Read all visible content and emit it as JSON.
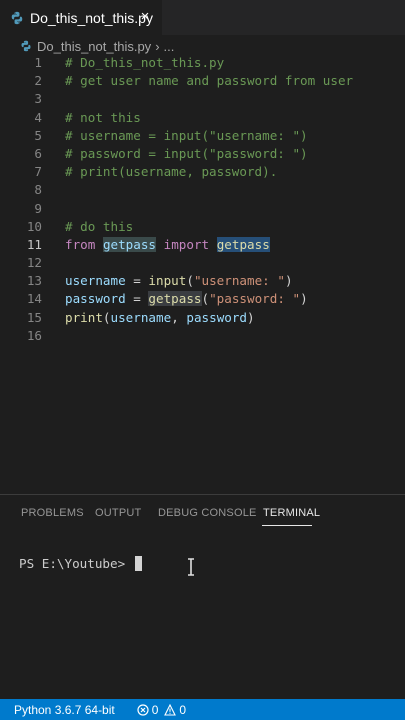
{
  "tab": {
    "filename": "Do_this_not_this.py",
    "close_glyph": "×"
  },
  "breadcrumb": {
    "file": "Do_this_not_this.py",
    "separator": "›",
    "more": "..."
  },
  "editor": {
    "active_line": 11,
    "lines": [
      {
        "n": "1",
        "tokens": [
          {
            "t": "# Do_this_not_this.py",
            "c": "c-comment"
          }
        ]
      },
      {
        "n": "2",
        "tokens": [
          {
            "t": "# get user name and password from user",
            "c": "c-comment"
          }
        ]
      },
      {
        "n": "3",
        "tokens": []
      },
      {
        "n": "4",
        "tokens": [
          {
            "t": "# not this",
            "c": "c-comment"
          }
        ]
      },
      {
        "n": "5",
        "tokens": [
          {
            "t": "# username = input(\"username: \")",
            "c": "c-comment"
          }
        ]
      },
      {
        "n": "6",
        "tokens": [
          {
            "t": "# password = input(\"password: \")",
            "c": "c-comment"
          }
        ]
      },
      {
        "n": "7",
        "tokens": [
          {
            "t": "# print(username, password).",
            "c": "c-comment"
          }
        ]
      },
      {
        "n": "8",
        "tokens": []
      },
      {
        "n": "9",
        "tokens": []
      },
      {
        "n": "10",
        "tokens": [
          {
            "t": "# do this",
            "c": "c-comment"
          }
        ]
      },
      {
        "n": "11",
        "tokens": [
          {
            "t": "from",
            "c": "c-kw"
          },
          {
            "t": " ",
            "c": "c-plain"
          },
          {
            "t": "getpass",
            "c": "c-var hl-word"
          },
          {
            "t": " ",
            "c": "c-plain"
          },
          {
            "t": "import",
            "c": "c-kw"
          },
          {
            "t": " ",
            "c": "c-plain"
          },
          {
            "t": "getpass",
            "c": "c-fn hl-word2"
          }
        ]
      },
      {
        "n": "12",
        "tokens": []
      },
      {
        "n": "13",
        "tokens": [
          {
            "t": "username",
            "c": "c-var"
          },
          {
            "t": " = ",
            "c": "c-plain"
          },
          {
            "t": "input",
            "c": "c-fn"
          },
          {
            "t": "(",
            "c": "c-plain"
          },
          {
            "t": "\"username: \"",
            "c": "c-str"
          },
          {
            "t": ")",
            "c": "c-plain"
          }
        ]
      },
      {
        "n": "14",
        "tokens": [
          {
            "t": "password",
            "c": "c-var"
          },
          {
            "t": " = ",
            "c": "c-plain"
          },
          {
            "t": "getpass",
            "c": "c-fn hl-fn"
          },
          {
            "t": "(",
            "c": "c-plain"
          },
          {
            "t": "\"password: \"",
            "c": "c-str"
          },
          {
            "t": ")",
            "c": "c-plain"
          }
        ]
      },
      {
        "n": "15",
        "tokens": [
          {
            "t": "print",
            "c": "c-fn"
          },
          {
            "t": "(",
            "c": "c-plain"
          },
          {
            "t": "username",
            "c": "c-var"
          },
          {
            "t": ", ",
            "c": "c-plain"
          },
          {
            "t": "password",
            "c": "c-var"
          },
          {
            "t": ")",
            "c": "c-plain"
          }
        ]
      },
      {
        "n": "16",
        "tokens": []
      }
    ]
  },
  "panel": {
    "tabs": [
      {
        "label": "PROBLEMS",
        "name": "tab-problems"
      },
      {
        "label": "OUTPUT",
        "name": "tab-output"
      },
      {
        "label": "DEBUG CONSOLE",
        "name": "tab-debug-console"
      },
      {
        "label": "TERMINAL",
        "name": "tab-terminal",
        "active": true
      }
    ],
    "terminal_prompt": "PS E:\\Youtube> "
  },
  "statusbar": {
    "interpreter": "Python 3.6.7 64-bit",
    "errors": "0",
    "warnings": "0"
  },
  "colors": {
    "accent": "#007acc",
    "editor_bg": "#1e1e1e",
    "tabbar_bg": "#252526"
  }
}
